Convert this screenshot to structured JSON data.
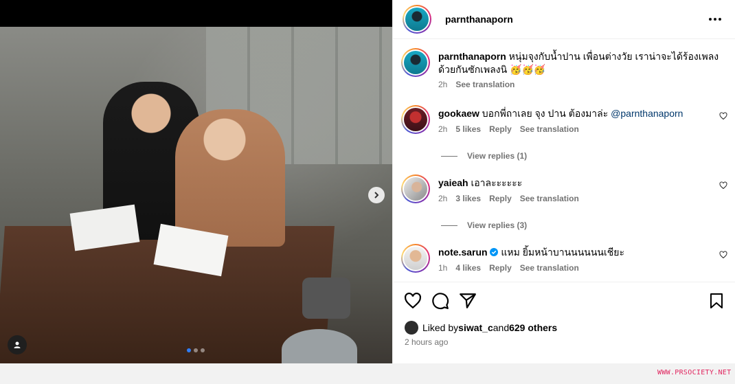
{
  "post": {
    "username": "parnthanaporn",
    "carousel": {
      "count": 3,
      "active": 1
    }
  },
  "caption": {
    "username": "parnthanaporn",
    "text": "หนุ่มจุงกับน้ำปาน เพื่อนต่างวัย เราน่าจะได้ร้องเพลงด้วยกันซักเพลงนิ 🥳🥳🥳",
    "time": "2h",
    "see_translation": "See translation"
  },
  "comments": [
    {
      "username": "gookaew",
      "text": "บอกพี่ถาเลย จุง ปาน ต้องมาล่ะ ",
      "mention": "@parnthanaporn",
      "time": "2h",
      "likes": "5 likes",
      "reply": "Reply",
      "see_translation": "See translation",
      "view_replies": "View replies (1)"
    },
    {
      "username": "yaieah",
      "text": "เอาละะะะะะ",
      "time": "2h",
      "likes": "3 likes",
      "reply": "Reply",
      "see_translation": "See translation",
      "view_replies": "View replies (3)"
    },
    {
      "username": "note.sarun",
      "text": "แหม ยิ้มหน้าบานนนนนนเชียะ",
      "time": "1h",
      "likes": "4 likes",
      "reply": "Reply",
      "see_translation": "See translation",
      "verified": true
    }
  ],
  "likes": {
    "prefix": "Liked by ",
    "user": "siwat_c",
    "and": " and ",
    "others": "629 others"
  },
  "posted": "2 hours ago",
  "watermark": "WWW.PRSOCIETY.NET",
  "colors": {
    "accent": "#0095f6",
    "link": "#00376b",
    "muted": "#737373"
  }
}
